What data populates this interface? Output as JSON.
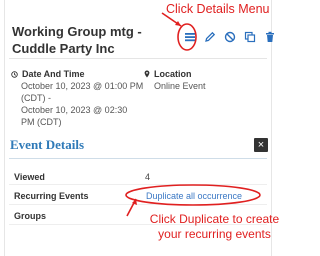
{
  "event": {
    "title": "Working Group mtg - Cuddle Party Inc"
  },
  "toolbar": {
    "icons": [
      "menu-icon",
      "edit-pencil-icon",
      "cancel-circle-icon",
      "copy-icon",
      "delete-trash-icon"
    ]
  },
  "info": {
    "date_label": "Date And Time",
    "date_value": "October 10, 2023 @ 01:00 PM\n(CDT) -\nOctober 10, 2023 @ 02:30\nPM (CDT)",
    "location_label": "Location",
    "location_value": "Online Event"
  },
  "details": {
    "title": "Event Details",
    "close_symbol": "×",
    "rows": [
      {
        "label": "Viewed",
        "value": "4"
      },
      {
        "label": "Recurring Events",
        "value": "Duplicate all occurrence"
      },
      {
        "label": "Groups",
        "value": ""
      }
    ]
  },
  "annotations": {
    "top": "Click Details Menu",
    "bottom": "Click Duplicate to create\nyour recurring events"
  },
  "colors": {
    "accent": "#2f7ab8",
    "link": "#3b78c4",
    "annotation": "#e02020"
  }
}
